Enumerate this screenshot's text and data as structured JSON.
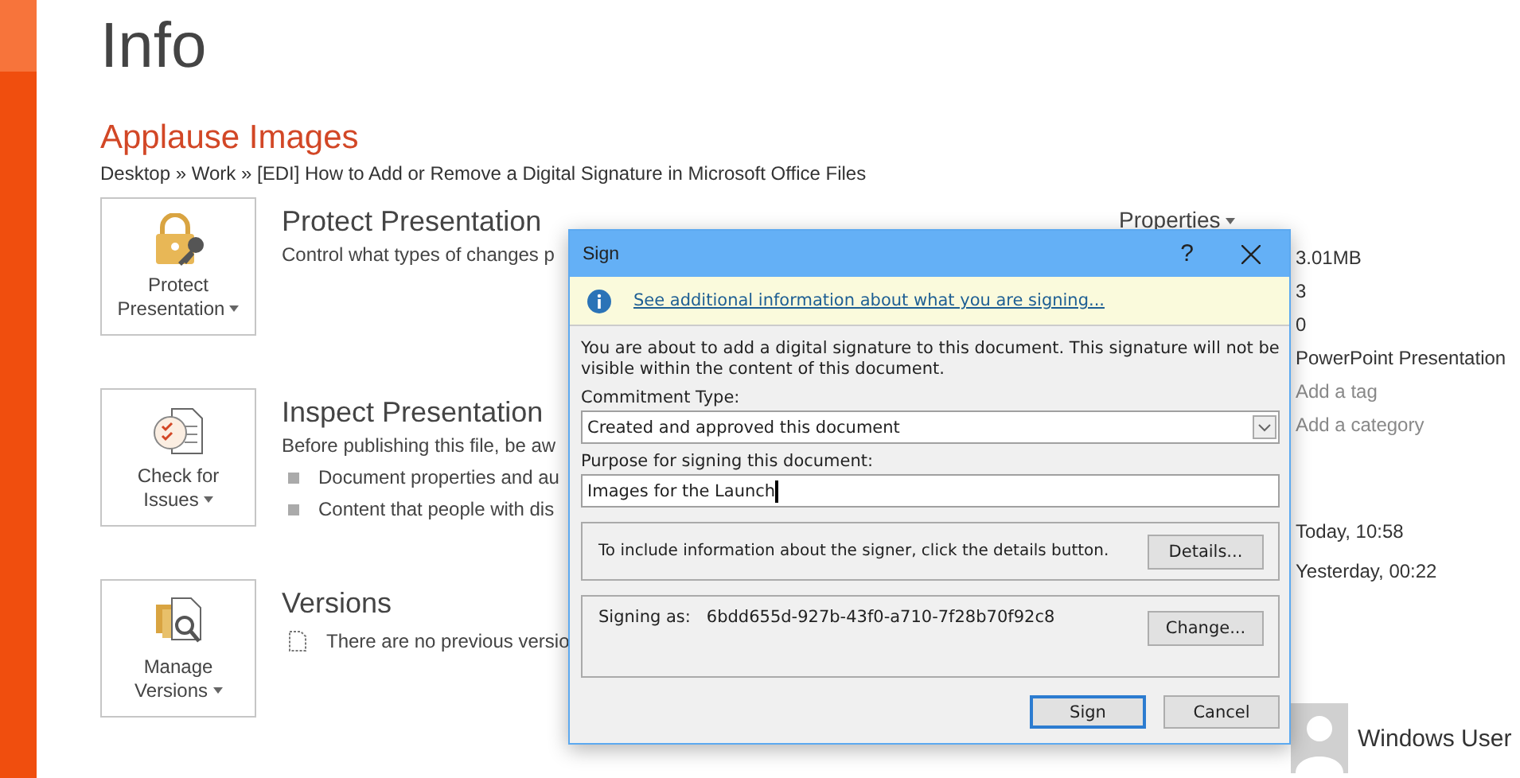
{
  "page": {
    "title": "Info",
    "file_name": "Applause Images",
    "breadcrumb": "Desktop » Work » [EDI] How to Add or Remove a Digital Signature in Microsoft Office Files"
  },
  "sections": [
    {
      "kind": "protect",
      "button": "Protect Presentation",
      "heading": "Protect Presentation",
      "description": "Control what types of changes p"
    },
    {
      "kind": "inspect",
      "button": "Check for Issues",
      "heading": "Inspect Presentation",
      "description": "Before publishing this file, be aw",
      "bullets": [
        "Document properties and au",
        "Content that people with dis"
      ]
    },
    {
      "kind": "versions",
      "button": "Manage Versions",
      "heading": "Versions",
      "note": "There are no previous versio"
    }
  ],
  "properties": {
    "header": "Properties",
    "values": [
      {
        "kind": "value",
        "text": "3.01MB"
      },
      {
        "kind": "value",
        "text": "3"
      },
      {
        "kind": "value",
        "text": "0"
      },
      {
        "kind": "value",
        "text": "PowerPoint Presentation"
      },
      {
        "kind": "hint",
        "text": "Add a tag"
      },
      {
        "kind": "hint",
        "text": "Add a category"
      }
    ],
    "dates": [
      "Today, 10:58",
      "Yesterday, 00:22"
    ],
    "author": "Windows User"
  },
  "dialog": {
    "title": "Sign",
    "help": "?",
    "info_link": "See additional information about what you are signing...",
    "description": "You are about to add a digital signature to this document. This signature will not be visible within the content of this document.",
    "commitment_label": "Commitment Type:",
    "commitment_value": "Created and approved this document",
    "purpose_label": "Purpose for signing this document:",
    "purpose_value": "Images for the Launch",
    "details_text": "To include information about the signer, click the details button.",
    "details_button": "Details...",
    "signing_label": "Signing as:",
    "signing_id": "6bdd655d-927b-43f0-a710-7f28b70f92c8",
    "change_button": "Change...",
    "buttons": [
      {
        "label": "Sign",
        "selected": true
      },
      {
        "label": "Cancel",
        "selected": false
      }
    ]
  }
}
